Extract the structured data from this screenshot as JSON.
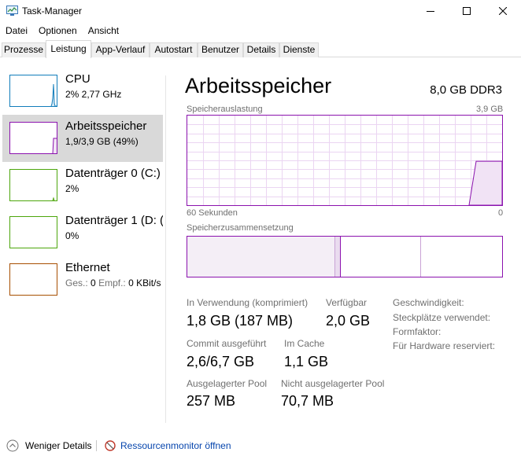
{
  "window": {
    "title": "Task-Manager"
  },
  "menu": [
    "Datei",
    "Optionen",
    "Ansicht"
  ],
  "tabs": [
    "Prozesse",
    "Leistung",
    "App-Verlauf",
    "Autostart",
    "Benutzer",
    "Details",
    "Dienste"
  ],
  "active_tab": "Leistung",
  "sidebar": {
    "items": [
      {
        "name": "CPU",
        "sub": "2% 2,77 GHz",
        "color": "#117dbb"
      },
      {
        "name": "Arbeitsspeicher",
        "sub": "1,9/3,9 GB (49%)",
        "color": "#8b12ae",
        "selected": true
      },
      {
        "name": "Datenträger 0 (C:)",
        "sub": "2%",
        "color": "#4da60c"
      },
      {
        "name": "Datenträger 1 (D: (",
        "sub": "0%",
        "color": "#4da60c"
      },
      {
        "name": "Ethernet",
        "sub_label1": "Ges.:",
        "sub_value1": "0",
        "sub_label2": "Empf.:",
        "sub_value2": "0 KBit/s",
        "color": "#a74f01"
      }
    ]
  },
  "main": {
    "title": "Arbeitsspeicher",
    "spec": "8,0 GB DDR3",
    "graph": {
      "label": "Speicherauslastung",
      "max_label": "3,9 GB",
      "x_left": "60 Sekunden",
      "x_right": "0",
      "usage_fraction": 0.49
    },
    "composition_label": "Speicherzusammensetzung",
    "stats": {
      "in_use_label": "In Verwendung (komprimiert)",
      "in_use_value": "1,8 GB (187 MB)",
      "available_label": "Verfügbar",
      "available_value": "2,0 GB",
      "commit_label": "Commit ausgeführt",
      "commit_value": "2,6/6,7 GB",
      "cache_label": "Im Cache",
      "cache_value": "1,1 GB",
      "paged_label": "Ausgelagerter Pool",
      "paged_value": "257 MB",
      "nonpaged_label": "Nicht ausgelagerter Pool",
      "nonpaged_value": "70,7 MB"
    },
    "properties": [
      "Geschwindigkeit:",
      "Steckplätze verwendet:",
      "Formfaktor:",
      "Für Hardware reserviert:"
    ]
  },
  "footer": {
    "fewer_details": "Weniger Details",
    "resource_monitor": "Ressourcenmonitor öffnen"
  },
  "colors": {
    "memory": "#8b12ae",
    "cpu": "#117dbb",
    "disk": "#4da60c",
    "ethernet": "#a74f01",
    "link": "#0645ad"
  }
}
